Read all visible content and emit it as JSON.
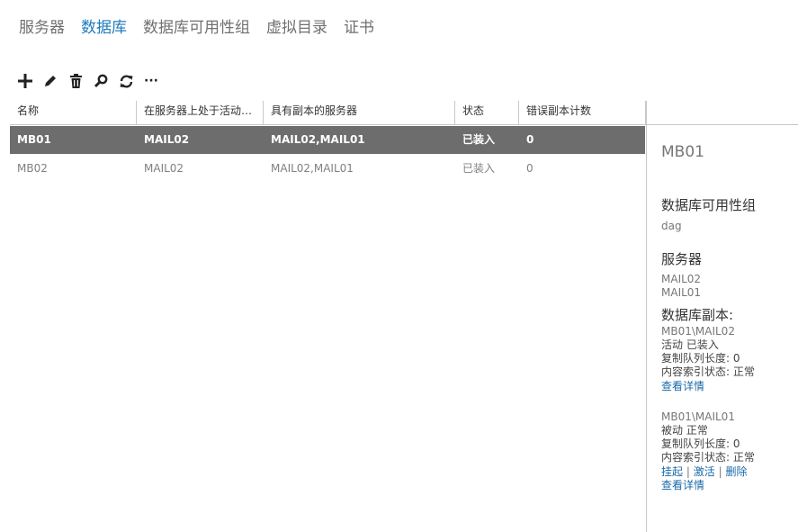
{
  "tabs": [
    {
      "label": "服务器",
      "active": false
    },
    {
      "label": "数据库",
      "active": true
    },
    {
      "label": "数据库可用性组",
      "active": false
    },
    {
      "label": "虚拟目录",
      "active": false
    },
    {
      "label": "证书",
      "active": false
    }
  ],
  "toolbar": {
    "icons": [
      "add-icon",
      "edit-icon",
      "delete-icon",
      "search-icon",
      "refresh-icon",
      "more-icon"
    ],
    "more_label": "···"
  },
  "table": {
    "columns": [
      "名称",
      "在服务器上处于活动…",
      "具有副本的服务器",
      "状态",
      "错误副本计数"
    ],
    "rows": [
      {
        "name": "MB01",
        "active_server": "MAIL02",
        "servers": "MAIL02,MAIL01",
        "status": "已装入",
        "bad_copies": "0",
        "selected": true
      },
      {
        "name": "MB02",
        "active_server": "MAIL02",
        "servers": "MAIL02,MAIL01",
        "status": "已装入",
        "bad_copies": "0",
        "selected": false
      }
    ]
  },
  "details": {
    "title": "MB01",
    "dag_heading": "数据库可用性组",
    "dag_value": "dag",
    "servers_heading": "服务器",
    "servers": [
      "MAIL02",
      "MAIL01"
    ],
    "copies_heading": "数据库副本:",
    "copy1": {
      "name": "MB01\\MAIL02",
      "status": "活动 已装入",
      "queue": "复制队列长度: 0",
      "index": "内容索引状态: 正常",
      "view_details": "查看详情"
    },
    "copy2": {
      "name": "MB01\\MAIL01",
      "status": "被动 正常",
      "queue": "复制队列长度: 0",
      "index": "内容索引状态: 正常",
      "suspend": "挂起",
      "activate": "激活",
      "remove": "删除",
      "separator": "|",
      "view_details": "查看详情"
    }
  },
  "colors": {
    "accent": "#1e7bbd",
    "selected_row": "#6d6d6d",
    "link": "#1b6aa8"
  }
}
